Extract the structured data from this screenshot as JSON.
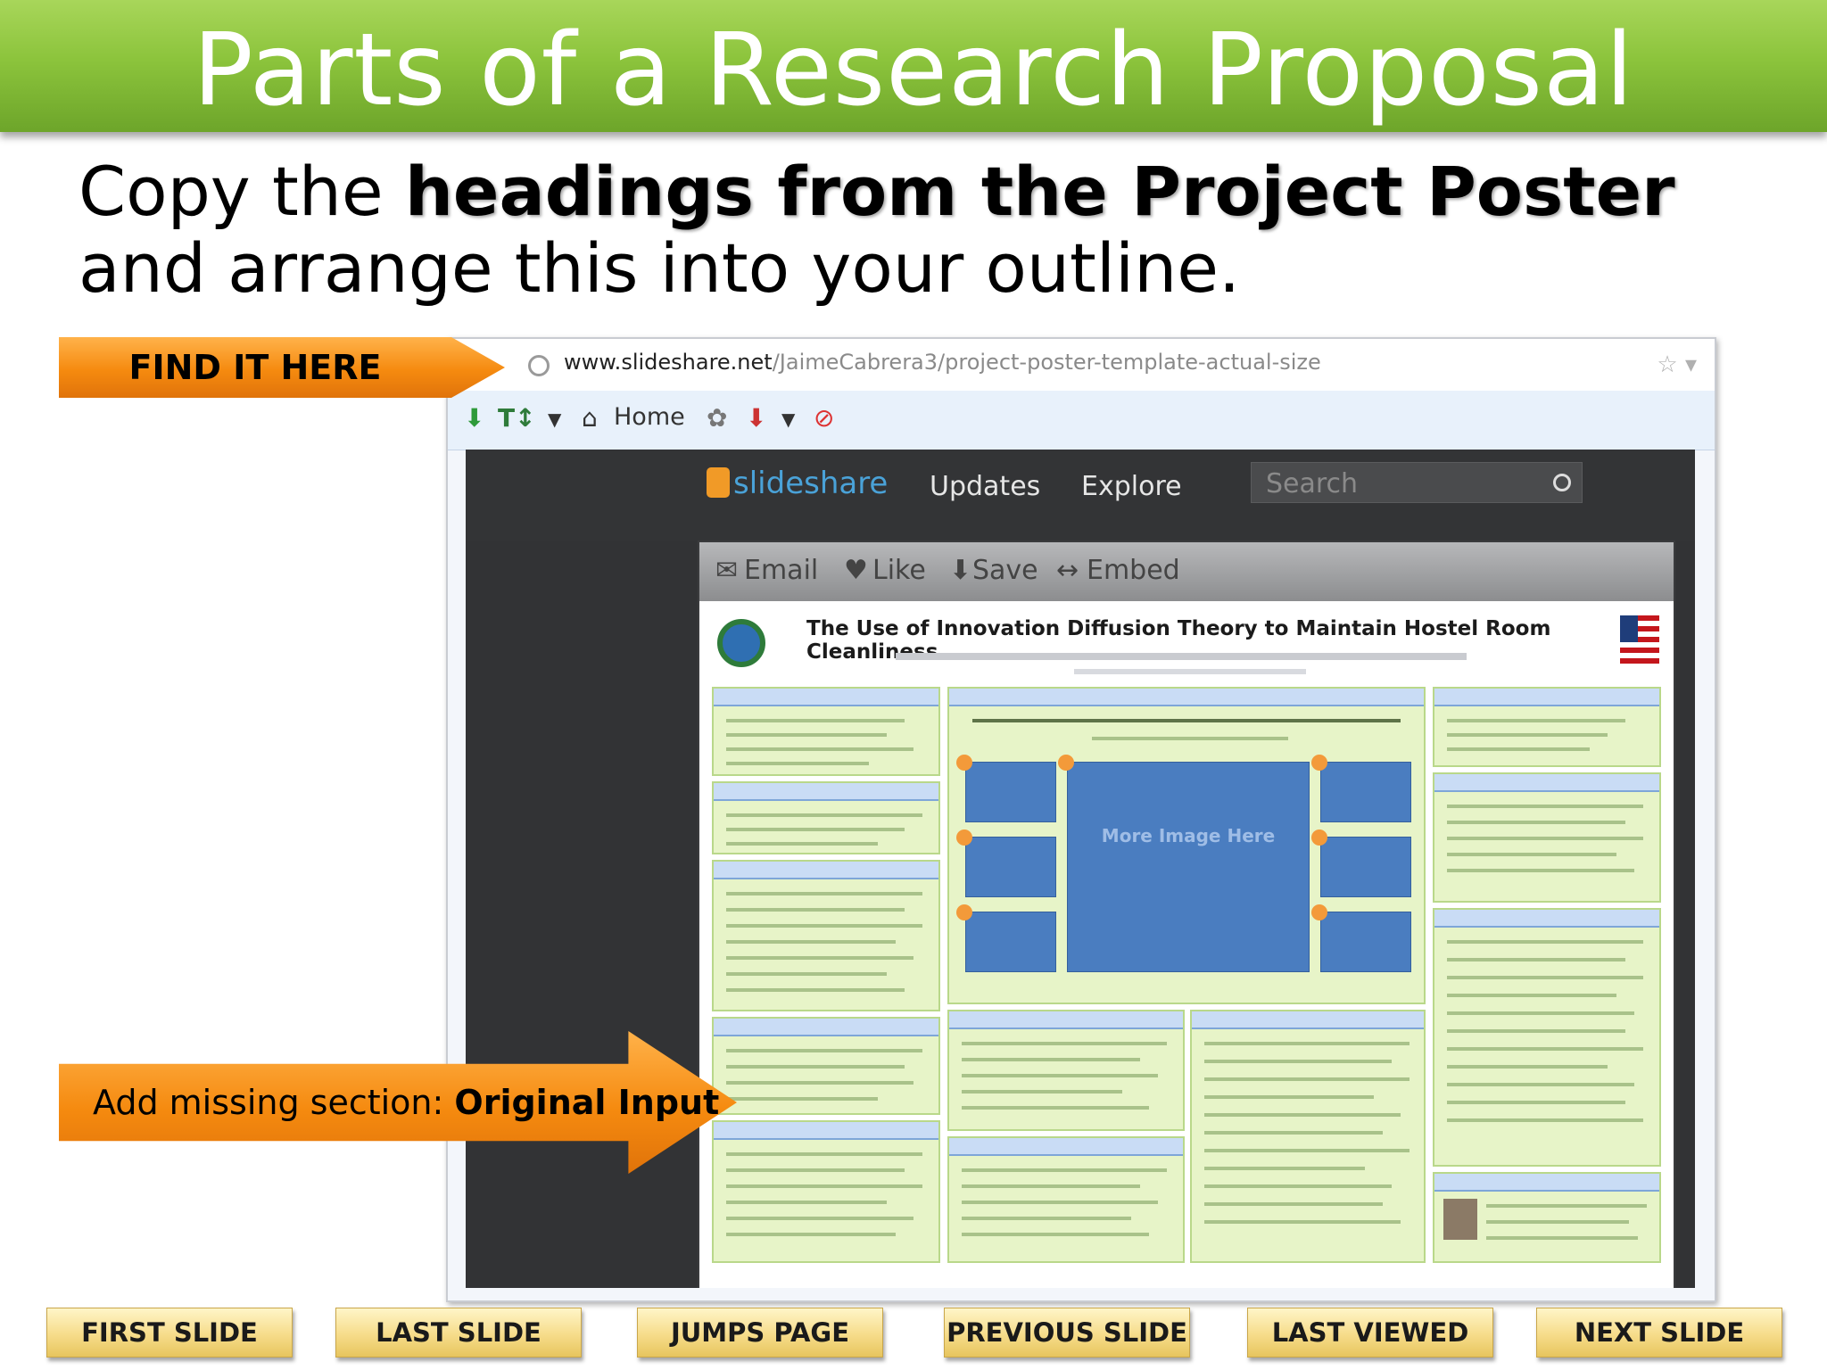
{
  "slide": {
    "title": "Parts of a Research Proposal",
    "instruction": {
      "part1": "Copy the ",
      "emphasis": "headings from the Project Poster",
      "part2": " and arrange this into your outline."
    },
    "find_label": "FIND IT HERE",
    "missing_label": "Add missing section: ",
    "missing_emphasis": "Original Input"
  },
  "browser": {
    "url_domain": "www.slideshare.net",
    "url_path": "/JaimeCabrera3/project-poster-template-actual-size",
    "toolbar_home": "Home"
  },
  "slideshare": {
    "logo": "slideshare",
    "nav_updates": "Updates",
    "nav_explore": "Explore",
    "search_placeholder": "Search",
    "actions": [
      "Email",
      "Like",
      "Save",
      "Embed"
    ]
  },
  "poster": {
    "title": "The Use of Innovation Diffusion Theory to Maintain Hostel Room Cleanliness",
    "image_placeholder": "More Image Here"
  },
  "nav_buttons": [
    "FIRST SLIDE",
    "LAST SLIDE",
    "JUMPS PAGE",
    "PREVIOUS SLIDE",
    "LAST VIEWED",
    "NEXT SLIDE"
  ],
  "colors": {
    "title_bar": "#8cc43c",
    "arrow_orange": "#f58a0f",
    "nav_button": "#f6dc8a"
  }
}
